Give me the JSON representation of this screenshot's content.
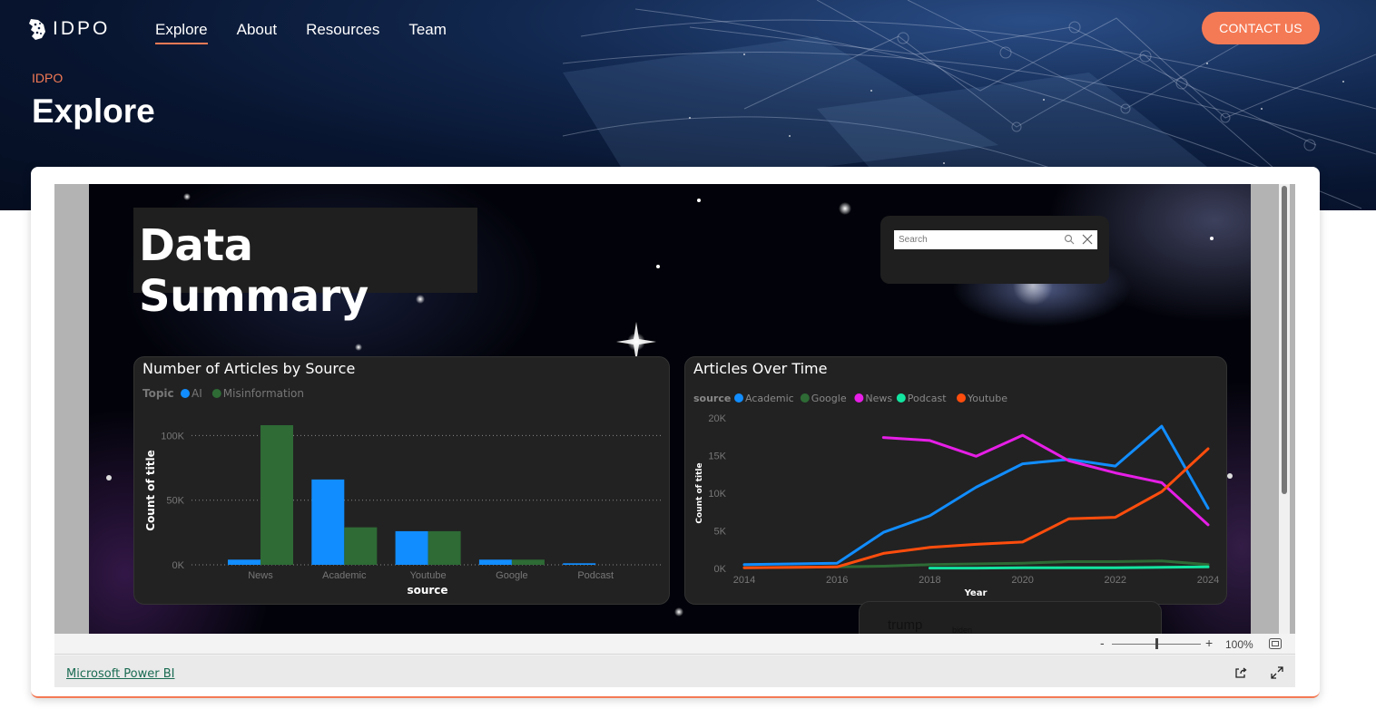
{
  "site": {
    "logo_text": "IDPO",
    "nav": [
      {
        "label": "Explore",
        "active": true
      },
      {
        "label": "About",
        "active": false
      },
      {
        "label": "Resources",
        "active": false
      },
      {
        "label": "Team",
        "active": false
      }
    ],
    "contact_label": "CONTACT US",
    "breadcrumb": "IDPO",
    "page_title": "Explore",
    "accent_color": "#f47a55"
  },
  "report": {
    "title": "Data Summary",
    "search": {
      "placeholder": "Search",
      "value": ""
    },
    "word_cloud": [
      "trump",
      "biden"
    ]
  },
  "chart_data": [
    {
      "type": "bar",
      "title": "Number of Articles by Source",
      "legend_title": "Topic",
      "xlabel": "source",
      "ylabel": "Count of title",
      "categories": [
        "News",
        "Academic",
        "Youtube",
        "Google",
        "Podcast"
      ],
      "series": [
        {
          "name": "AI",
          "color": "#118dff",
          "values": [
            4000,
            66000,
            26000,
            4000,
            1200
          ]
        },
        {
          "name": "Misinformation",
          "color": "#2e6b35",
          "values": [
            108000,
            29000,
            26000,
            4000,
            0
          ]
        }
      ],
      "yticks": [
        "0K",
        "50K",
        "100K"
      ],
      "ylim": [
        0,
        115000
      ],
      "grid": true,
      "legend_position": "top-left"
    },
    {
      "type": "line",
      "title": "Articles Over Time",
      "legend_title": "source",
      "xlabel": "Year",
      "ylabel": "Count of title",
      "xticks": [
        "2014",
        "2016",
        "2018",
        "2020",
        "2022",
        "2024"
      ],
      "yticks": [
        "0K",
        "5K",
        "10K",
        "15K",
        "20K"
      ],
      "xlim": [
        2014,
        2024
      ],
      "ylim": [
        0,
        20000
      ],
      "series": [
        {
          "name": "Academic",
          "color": "#118dff",
          "points": [
            [
              2014,
              500
            ],
            [
              2016,
              700
            ],
            [
              2017,
              4800
            ],
            [
              2018,
              7000
            ],
            [
              2019,
              10800
            ],
            [
              2020,
              13900
            ],
            [
              2021,
              14500
            ],
            [
              2022,
              13600
            ],
            [
              2023,
              18900
            ],
            [
              2024,
              8000
            ]
          ]
        },
        {
          "name": "Google",
          "color": "#2e6b35",
          "points": [
            [
              2014,
              100
            ],
            [
              2016,
              200
            ],
            [
              2017,
              300
            ],
            [
              2018,
              500
            ],
            [
              2019,
              600
            ],
            [
              2020,
              700
            ],
            [
              2021,
              900
            ],
            [
              2022,
              900
            ],
            [
              2023,
              1000
            ],
            [
              2024,
              500
            ]
          ]
        },
        {
          "name": "News",
          "color": "#e61ee6",
          "points": [
            [
              2017,
              17400
            ],
            [
              2018,
              17000
            ],
            [
              2019,
              14900
            ],
            [
              2020,
              17700
            ],
            [
              2021,
              14300
            ],
            [
              2022,
              12700
            ],
            [
              2023,
              11400
            ],
            [
              2024,
              5800
            ]
          ]
        },
        {
          "name": "Podcast",
          "color": "#12e5a0",
          "points": [
            [
              2018,
              50
            ],
            [
              2019,
              50
            ],
            [
              2020,
              80
            ],
            [
              2021,
              100
            ],
            [
              2022,
              100
            ],
            [
              2023,
              150
            ],
            [
              2024,
              200
            ]
          ]
        },
        {
          "name": "Youtube",
          "color": "#ff4d0d",
          "points": [
            [
              2014,
              100
            ],
            [
              2016,
              200
            ],
            [
              2017,
              2000
            ],
            [
              2018,
              2800
            ],
            [
              2019,
              3200
            ],
            [
              2020,
              3500
            ],
            [
              2021,
              6600
            ],
            [
              2022,
              6800
            ],
            [
              2023,
              10200
            ],
            [
              2024,
              15900
            ]
          ]
        }
      ],
      "grid": false,
      "legend_position": "top-left"
    }
  ],
  "viewer": {
    "zoom_minus": "-",
    "zoom_plus": "+",
    "zoom_value": "100%",
    "powerbi_link": "Microsoft Power BI"
  }
}
